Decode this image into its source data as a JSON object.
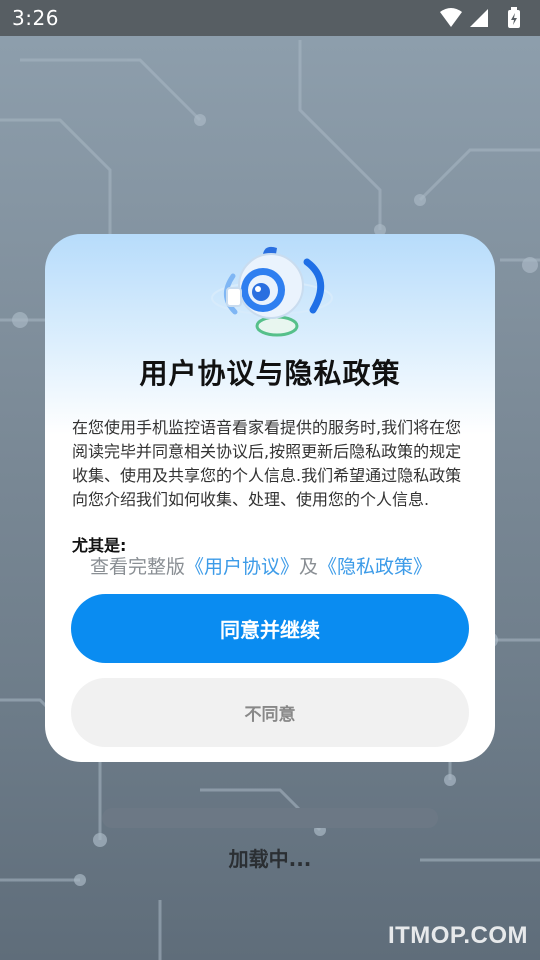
{
  "status_bar": {
    "time": "3:26",
    "icons": [
      "wifi-icon",
      "signal-icon",
      "battery-icon"
    ]
  },
  "dialog": {
    "title": "用户协议与隐私政策",
    "body": "在您使用手机监控语音看家看提供的服务时,我们将在您阅读完毕并同意相关协议后,按照更新后隐私政策的规定收集、使用及共享您的个人信息.我们希望通过隐私政策向您介绍我们如何收集、处理、使用您的个人信息.",
    "note_label": "尤其是:",
    "links": {
      "prefix": "查看完整版",
      "user_agreement": "《用户协议》",
      "joiner": "及",
      "privacy_policy": "《隐私政策》"
    },
    "agree_label": "同意并继续",
    "disagree_label": "不同意"
  },
  "loading": {
    "text": "加载中..."
  },
  "watermark": {
    "text": "ITMOP.COM"
  },
  "colors": {
    "primary_button": "#0a8cf1",
    "link": "#3c9be8",
    "status_bar": "#575e63"
  }
}
